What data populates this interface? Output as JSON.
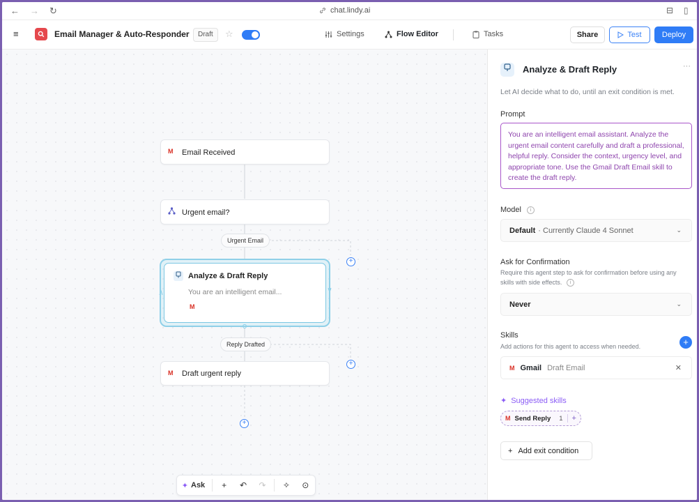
{
  "browser": {
    "back": "←",
    "forward": "→",
    "reload": "↻",
    "url": "chat.lindy.ai",
    "reader": "⊟",
    "sidebar": "▯"
  },
  "header": {
    "menu": "≡",
    "app_title": "Email Manager & Auto-Responder",
    "chevron": "⌄",
    "status_badge": "Draft",
    "star": "☆",
    "nav": {
      "settings": "Settings",
      "flow_editor": "Flow Editor",
      "tasks": "Tasks"
    },
    "share": "Share",
    "test": "Test",
    "deploy": "Deploy"
  },
  "flow": {
    "nodes": {
      "email_received": "Email Received",
      "urgent_condition": "Urgent email?",
      "analyze": "Analyze & Draft Reply",
      "analyze_subtitle": "You are an intelligent email...",
      "draft_reply": "Draft urgent reply"
    },
    "edge_labels": {
      "urgent_email": "Urgent Email",
      "reply_drafted": "Reply Drafted"
    },
    "gmail_glyph": "M",
    "plus": "+"
  },
  "toolbar": {
    "ask": "Ask",
    "add": "+",
    "undo": "↶",
    "redo": "↷",
    "magic": "✧",
    "fit": "⊙"
  },
  "panel": {
    "title": "Analyze & Draft Reply",
    "more": "···",
    "description": "Let AI decide what to do, until an exit condition is met.",
    "prompt_label": "Prompt",
    "prompt_text": "You are an intelligent email assistant. Analyze the urgent email content carefully and draft a professional, helpful reply. Consider the context, urgency level, and appropriate tone. Use the Gmail Draft Email skill to create the draft reply.",
    "model_label": "Model",
    "model_value": "Default",
    "model_detail": "· Currently Claude 4 Sonnet",
    "confirm_label": "Ask for Confirmation",
    "confirm_help": "Require this agent step to ask for confirmation before using any skills with side effects.",
    "confirm_value": "Never",
    "skills_label": "Skills",
    "skills_help": "Add actions for this agent to access when needed.",
    "skill": {
      "app": "Gmail",
      "action": "Draft Email"
    },
    "suggested_label": "Suggested skills",
    "suggested_chip": {
      "label": "Send Reply",
      "count": "1"
    },
    "exit_condition": "Add exit condition"
  },
  "colors": {
    "accent": "#2f7cf6",
    "prompt_purple": "#8e44ad",
    "gmail_red": "#d93025",
    "logo_red": "#e5484d"
  }
}
